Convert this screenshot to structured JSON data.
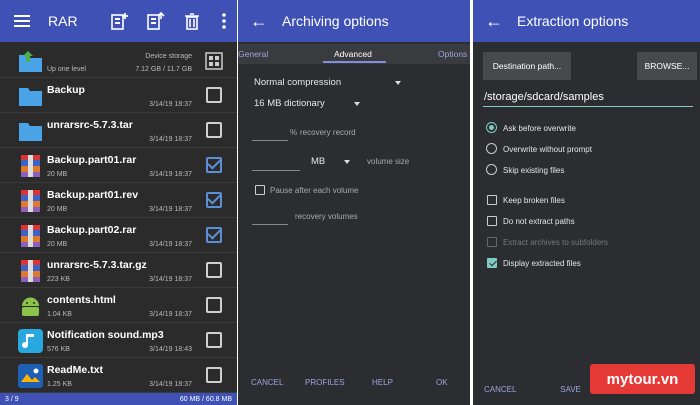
{
  "rar": {
    "title": "RAR",
    "icons": [
      "menu-icon",
      "add-archive-icon",
      "extract-archive-icon",
      "delete-icon",
      "overflow-icon"
    ],
    "files": [
      {
        "name": "",
        "size": "Up one level",
        "date": "7.12 GB / 11.7 GB",
        "extra": "Device storage",
        "icon": "up-folder-icon",
        "checked": false
      },
      {
        "name": "Backup",
        "size": "",
        "date": "3/14/19 18:37",
        "icon": "folder-icon",
        "checked": false
      },
      {
        "name": "unrarsrc-5.7.3.tar",
        "size": "",
        "date": "3/14/19 18:37",
        "icon": "folder-icon",
        "checked": false
      },
      {
        "name": "Backup.part01.rar",
        "size": "20 MB",
        "date": "3/14/19 18:37",
        "icon": "rar-icon",
        "checked": true
      },
      {
        "name": "Backup.part01.rev",
        "size": "20 MB",
        "date": "3/14/19 18:37",
        "icon": "rar-icon",
        "checked": true
      },
      {
        "name": "Backup.part02.rar",
        "size": "20 MB",
        "date": "3/14/19 18:37",
        "icon": "rar-icon",
        "checked": true
      },
      {
        "name": "unrarsrc-5.7.3.tar.gz",
        "size": "223 KB",
        "date": "3/14/19 18:37",
        "icon": "rar-icon",
        "checked": false
      },
      {
        "name": "contents.html",
        "size": "1.04 KB",
        "date": "3/14/19 18:37",
        "icon": "android-icon",
        "checked": false
      },
      {
        "name": "Notification sound.mp3",
        "size": "576 KB",
        "date": "3/14/19 18:43",
        "icon": "music-icon",
        "checked": false
      },
      {
        "name": "ReadMe.txt",
        "size": "1.25 KB",
        "date": "3/14/19 18:37",
        "icon": "viewer-icon",
        "checked": false
      }
    ],
    "status_left": "3 / 9",
    "status_right": "60 MB / 60.8 MB"
  },
  "archiving": {
    "title": "Archiving options",
    "tabs": [
      "General",
      "Advanced",
      "Options"
    ],
    "compression": "Normal compression",
    "dictionary": "16 MB dictionary",
    "recovery_record": "recovery record",
    "percent": "%",
    "unit": "MB",
    "volume_size": "volume size",
    "pause": "Pause after each volume",
    "recovery_volumes": "recovery volumes",
    "buttons": {
      "cancel": "CANCEL",
      "profiles": "PROFILES",
      "help": "HELP",
      "ok": "OK"
    }
  },
  "extraction": {
    "title": "Extraction options",
    "dest_button": "Destination path...",
    "browse_button": "BROWSE...",
    "path": "/storage/sdcard/samples",
    "radios": [
      "Ask before overwrite",
      "Overwrite without prompt",
      "Skip existing files"
    ],
    "checks": [
      {
        "label": "Keep broken files",
        "state": "off"
      },
      {
        "label": "Do not extract paths",
        "state": "off"
      },
      {
        "label": "Extract archives to subfolders",
        "state": "disabled"
      },
      {
        "label": "Display extracted files",
        "state": "on"
      }
    ],
    "buttons": {
      "cancel": "CANCEL",
      "save": "SAVE SETTINGS"
    }
  },
  "watermark": "mytour.vn",
  "colors": {
    "toolbar": "#3f51b5",
    "accent": "#80cbc4",
    "check": "#5c8fd6"
  }
}
